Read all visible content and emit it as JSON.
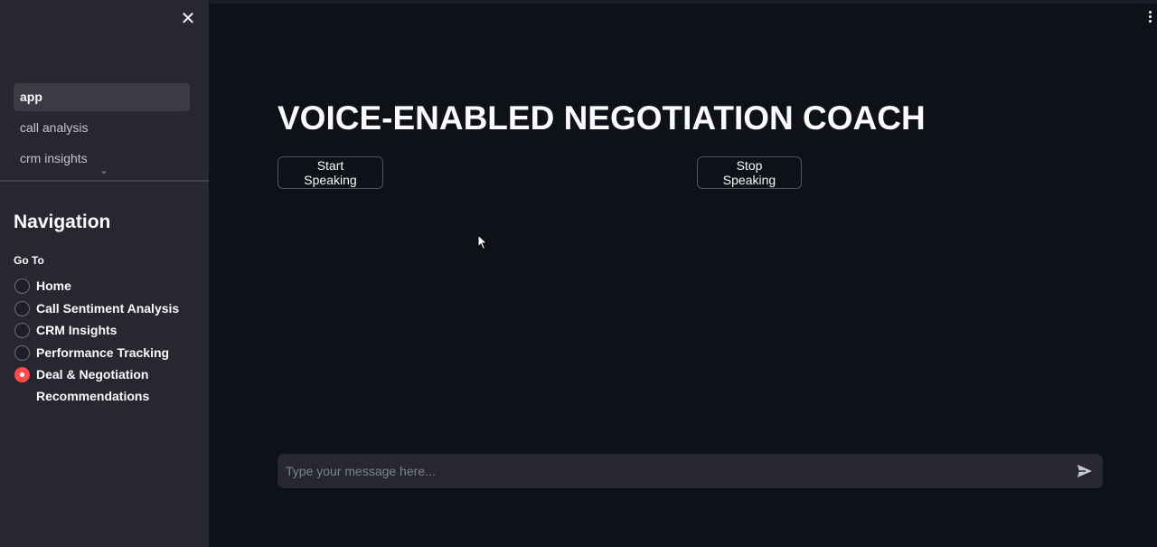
{
  "sidebar": {
    "close_icon": "close-icon",
    "pages": [
      {
        "label": "app",
        "active": true
      },
      {
        "label": "call analysis",
        "active": false
      },
      {
        "label": "crm insights",
        "active": false
      }
    ],
    "expand_icon": "chevron-down-icon",
    "nav_title": "Navigation",
    "radio_label": "Go To",
    "options": [
      {
        "label": "Home",
        "checked": false
      },
      {
        "label": "Call Sentiment Analysis",
        "checked": false
      },
      {
        "label": "CRM Insights",
        "checked": false
      },
      {
        "label": "Performance Tracking",
        "checked": false
      },
      {
        "label": "Deal & Negotiation Recommendations",
        "checked": true
      }
    ]
  },
  "main": {
    "title": "VOICE-ENABLED NEGOTIATION COACH",
    "start_button": "Start Speaking",
    "stop_button": "Stop Speaking",
    "chat_placeholder": "Type your message here...",
    "chat_value": "",
    "send_icon": "send-icon",
    "menu_icon": "kebab-menu-icon"
  },
  "colors": {
    "background": "#0e1117",
    "sidebar": "#262730",
    "accent": "#ff4b4b",
    "text": "#fafafa"
  }
}
